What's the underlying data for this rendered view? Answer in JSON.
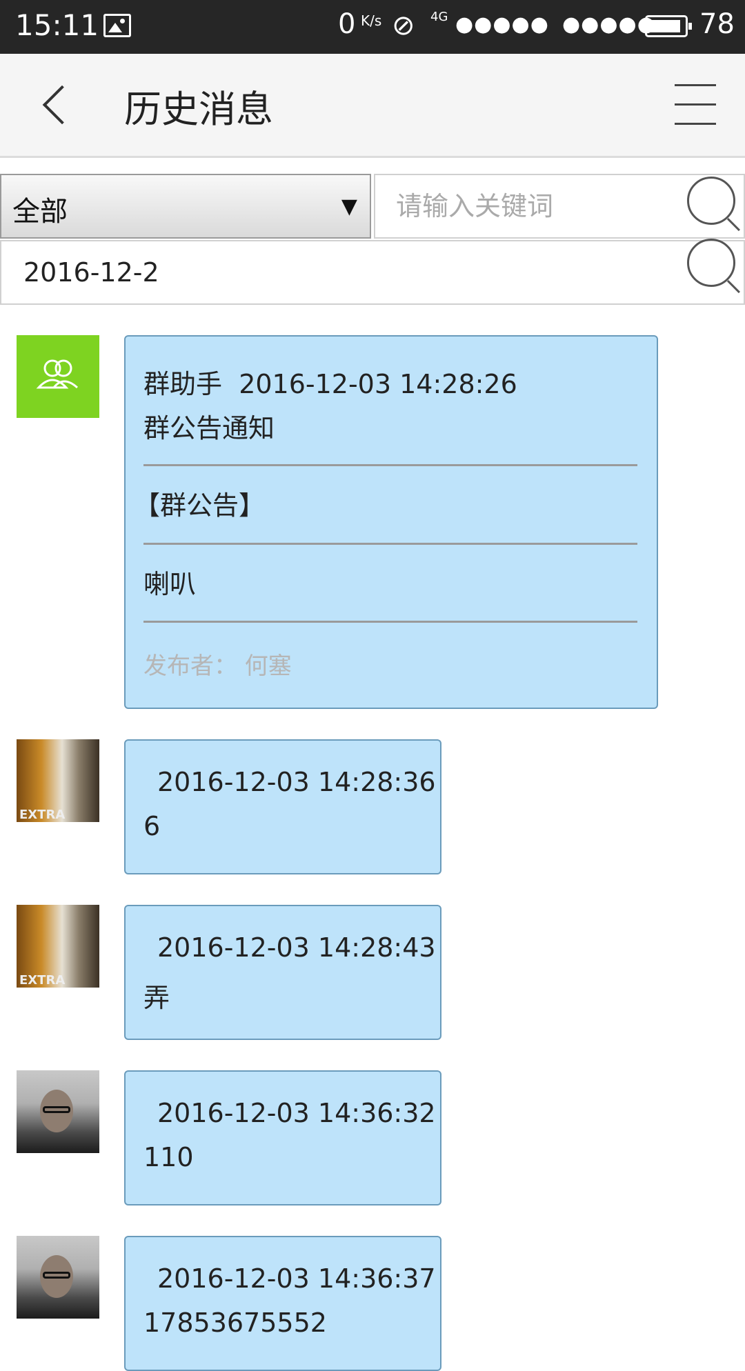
{
  "status_bar": {
    "time": "15:11",
    "net_speed": "0",
    "net_speed_unit": "K/s",
    "network": "4G",
    "signal1": "●●●●●",
    "signal2": "●●●●●",
    "battery": "78",
    "icons": [
      "image-icon",
      "mute-icon",
      "battery-icon"
    ]
  },
  "header": {
    "title": "历史消息",
    "back_icon": "chevron-left-icon",
    "menu_icon": "hamburger-menu-icon"
  },
  "filter": {
    "select_value": "全部",
    "select_arrow": "▼",
    "search_placeholder": "请输入关键词",
    "date_value": "2016-12-2"
  },
  "messages": [
    {
      "sender": "群助手",
      "time": "2016-12-03 14:28:26",
      "subtitle": "群公告通知",
      "heading": "【群公告】",
      "content": "喇叭",
      "publisher": "发布者： 何塞",
      "avatar": "group-icon"
    },
    {
      "time": "2016-12-03 14:28:36",
      "content": "6",
      "avatar": "earphone-photo"
    },
    {
      "time": "2016-12-03 14:28:43",
      "content": "弄",
      "avatar": "earphone-photo"
    },
    {
      "time": "2016-12-03 14:36:32",
      "content": "110",
      "avatar": "face-photo"
    },
    {
      "time": "2016-12-03 14:36:37",
      "content": "17853675552",
      "avatar": "face-photo"
    }
  ],
  "colors": {
    "status_bar_bg": "#262626",
    "header_bg": "#f5f5f5",
    "bubble_bg": "#bee3fa",
    "bubble_border": "#6a9bbb",
    "group_avatar_bg": "#7ed321"
  }
}
